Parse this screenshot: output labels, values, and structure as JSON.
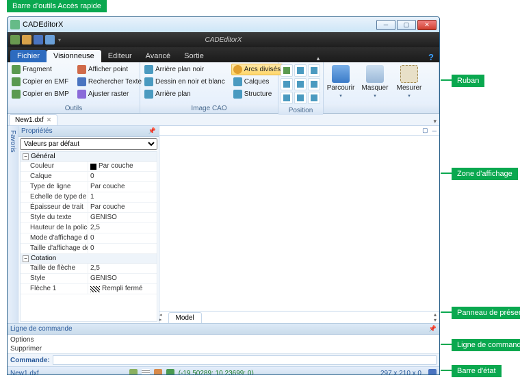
{
  "window": {
    "title": "CADEditorX",
    "appname": "CADEditorX"
  },
  "callouts": {
    "qab": "Barre d'outils Accès rapide",
    "ribbon": "Ruban",
    "viewport": "Zone d'affichage",
    "layout": "Panneau de présentation",
    "cmd": "Ligne de commande",
    "status": "Barre d'état"
  },
  "tabs": {
    "file": "Fichier",
    "items": [
      "Visionneuse",
      "Editeur",
      "Avancé",
      "Sortie"
    ]
  },
  "ribbon": {
    "outils": {
      "label": "Outils",
      "col1": [
        "Fragment",
        "Copier en EMF",
        "Copier en BMP"
      ],
      "col2": [
        "Afficher point",
        "Rechercher Texte",
        "Ajuster raster"
      ]
    },
    "imagecao": {
      "label": "Image CAO",
      "col1": [
        "Arrière plan noir",
        "Dessin en noir et blanc",
        "Arrière plan"
      ],
      "col2": [
        "Arcs divisés",
        "Calques",
        "Structure"
      ]
    },
    "position": {
      "label": "Position"
    },
    "big": {
      "parcourir": "Parcourir",
      "masquer": "Masquer",
      "mesurer": "Mesurer"
    }
  },
  "doc": {
    "tab": "New1.dxf"
  },
  "side": {
    "favorites": "Favoris"
  },
  "props": {
    "title": "Propriétés",
    "selector": "Valeurs par défaut",
    "groups": [
      {
        "name": "Général",
        "rows": [
          {
            "k": "Couleur",
            "v": "Par couche",
            "swatch": true
          },
          {
            "k": "Calque",
            "v": "0"
          },
          {
            "k": "Type de ligne",
            "v": "Par couche"
          },
          {
            "k": "Echelle de type de l",
            "v": "1"
          },
          {
            "k": "Épaisseur de trait",
            "v": "Par couche"
          },
          {
            "k": "Style du texte",
            "v": "GENISO"
          },
          {
            "k": "Hauteur de la police",
            "v": "2,5"
          },
          {
            "k": "Mode d'affichage de",
            "v": "0"
          },
          {
            "k": "Taille d'affichage de",
            "v": "0"
          }
        ]
      },
      {
        "name": "Cotation",
        "rows": [
          {
            "k": "Taille de flèche",
            "v": "2,5"
          },
          {
            "k": "Style",
            "v": "GENISO"
          },
          {
            "k": "Flèche 1",
            "v": "Rempli fermé",
            "patt": true
          }
        ]
      }
    ]
  },
  "model": {
    "tab": "Model"
  },
  "cmd": {
    "title": "Ligne de commande",
    "hist": [
      "Options",
      "Supprimer"
    ],
    "label": "Commande:"
  },
  "status": {
    "file": "New1.dxf",
    "coords": "(-19,50289; 10,23699; 0)",
    "dims": "297 x 210 x 0"
  }
}
